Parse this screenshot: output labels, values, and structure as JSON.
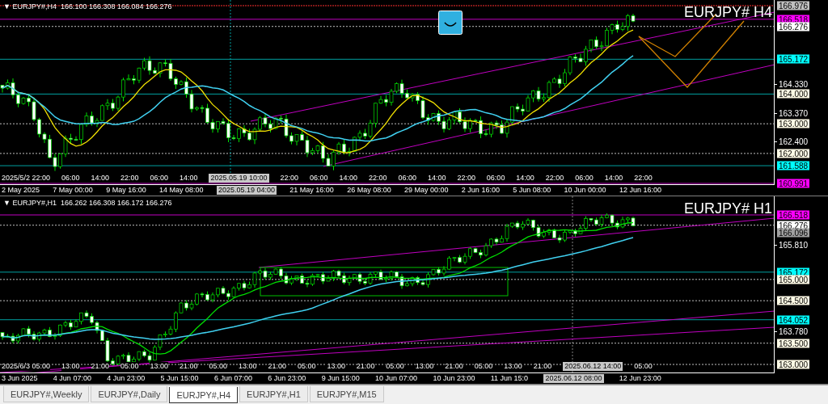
{
  "panes": [
    {
      "header": "▼ EURJPY#,H4  166.100 166.308 166.084 166.276",
      "symbol_label": "EURJPY# H4",
      "price_labels": [
        {
          "text": "166.976",
          "kind": "tag",
          "color": "#c0c0c0"
        },
        {
          "text": "166.518",
          "kind": "tag",
          "color": "#ff00ff"
        },
        {
          "text": "166.276",
          "kind": "tag",
          "color": "#ffffff"
        },
        {
          "text": "165.172",
          "kind": "tag",
          "color": "#00ffff"
        },
        {
          "text": "164.330",
          "kind": "tick"
        },
        {
          "text": "164.000",
          "kind": "tag",
          "color": "#fffbe6"
        },
        {
          "text": "163.370",
          "kind": "tick"
        },
        {
          "text": "163.000",
          "kind": "tag",
          "color": "#fffbe6"
        },
        {
          "text": "162.400",
          "kind": "tick"
        },
        {
          "text": "162.000",
          "kind": "tag",
          "color": "#fffbe6"
        },
        {
          "text": "161.588",
          "kind": "tag",
          "color": "#00ffff"
        },
        {
          "text": "160.991",
          "kind": "tag",
          "color": "#ff00ff"
        }
      ],
      "upper_time_labels": [
        {
          "text": "2025/5/2 22:00",
          "kind": "tick"
        },
        {
          "text": "06:00",
          "kind": "tick"
        },
        {
          "text": "14:00",
          "kind": "tick"
        },
        {
          "text": "22:00",
          "kind": "tick"
        },
        {
          "text": "06:00",
          "kind": "tick"
        },
        {
          "text": "14:00",
          "kind": "tick"
        },
        {
          "text": "2025.05.19 10:00",
          "kind": "crosshair"
        },
        {
          "text": "22:00",
          "kind": "tick"
        },
        {
          "text": "06:00",
          "kind": "tick"
        },
        {
          "text": "14:00",
          "kind": "tick"
        },
        {
          "text": "22:00",
          "kind": "tick"
        },
        {
          "text": "06:00",
          "kind": "tick"
        },
        {
          "text": "14:00",
          "kind": "tick"
        },
        {
          "text": "22:00",
          "kind": "tick"
        },
        {
          "text": "06:00",
          "kind": "tick"
        },
        {
          "text": "14:00",
          "kind": "tick"
        },
        {
          "text": "22:00",
          "kind": "tick"
        },
        {
          "text": "06:00",
          "kind": "tick"
        },
        {
          "text": "14:00",
          "kind": "tick"
        },
        {
          "text": "22:00",
          "kind": "tick"
        }
      ],
      "time_labels": [
        {
          "text": "2 May 2025",
          "kind": "tick"
        },
        {
          "text": "7 May 00:00",
          "kind": "tick"
        },
        {
          "text": "9 May 16:00",
          "kind": "tick"
        },
        {
          "text": "14 May 08:00",
          "kind": "tick"
        },
        {
          "text": "2025.05.19 04:00",
          "kind": "crosshair"
        },
        {
          "text": "21 May 16:00",
          "kind": "tick"
        },
        {
          "text": "26 May 08:00",
          "kind": "tick"
        },
        {
          "text": "29 May 00:00",
          "kind": "tick"
        },
        {
          "text": "2 Jun 16:00",
          "kind": "tick"
        },
        {
          "text": "5 Jun 08:00",
          "kind": "tick"
        },
        {
          "text": "10 Jun 00:00",
          "kind": "tick"
        },
        {
          "text": "12 Jun 16:00",
          "kind": "tick"
        }
      ]
    },
    {
      "header": "▼ EURJPY#,H1  166.262 166.308 166.172 166.276",
      "symbol_label": "EURJPY# H1",
      "price_labels": [
        {
          "text": "166.518",
          "kind": "tag",
          "color": "#ff00ff"
        },
        {
          "text": "166.276",
          "kind": "tag",
          "color": "#ffffff"
        },
        {
          "text": "166.096",
          "kind": "tag",
          "color": "#a0a0a0"
        },
        {
          "text": "165.810",
          "kind": "tick"
        },
        {
          "text": "165.172",
          "kind": "tag",
          "color": "#00ffff"
        },
        {
          "text": "165.000",
          "kind": "tag",
          "color": "#fffbe6"
        },
        {
          "text": "164.500",
          "kind": "tag",
          "color": "#fffbe6"
        },
        {
          "text": "164.052",
          "kind": "tag",
          "color": "#00ffff"
        },
        {
          "text": "163.780",
          "kind": "tick"
        },
        {
          "text": "163.500",
          "kind": "tag",
          "color": "#fffbe6"
        },
        {
          "text": "163.000",
          "kind": "tag",
          "color": "#fffbe6"
        }
      ],
      "upper_time_labels": [
        {
          "text": "2025/6/3 05:00",
          "kind": "tick"
        },
        {
          "text": "13:00",
          "kind": "tick"
        },
        {
          "text": "21:00",
          "kind": "tick"
        },
        {
          "text": "05:00",
          "kind": "tick"
        },
        {
          "text": "13:00",
          "kind": "tick"
        },
        {
          "text": "21:00",
          "kind": "tick"
        },
        {
          "text": "05:00",
          "kind": "tick"
        },
        {
          "text": "13:00",
          "kind": "tick"
        },
        {
          "text": "21:00",
          "kind": "tick"
        },
        {
          "text": "05:00",
          "kind": "tick"
        },
        {
          "text": "13:00",
          "kind": "tick"
        },
        {
          "text": "21:00",
          "kind": "tick"
        },
        {
          "text": "05:00",
          "kind": "tick"
        },
        {
          "text": "13:00",
          "kind": "tick"
        },
        {
          "text": "21:00",
          "kind": "tick"
        },
        {
          "text": "05:00",
          "kind": "tick"
        },
        {
          "text": "13:00",
          "kind": "tick"
        },
        {
          "text": "21:00",
          "kind": "tick"
        },
        {
          "text": "2025.06.12 14:00",
          "kind": "crosshair"
        },
        {
          "text": "05:00",
          "kind": "tick"
        }
      ],
      "time_labels": [
        {
          "text": "3 Jun 2025",
          "kind": "tick"
        },
        {
          "text": "4 Jun 07:00",
          "kind": "tick"
        },
        {
          "text": "4 Jun 23:00",
          "kind": "tick"
        },
        {
          "text": "5 Jun 15:00",
          "kind": "tick"
        },
        {
          "text": "6 Jun 07:00",
          "kind": "tick"
        },
        {
          "text": "6 Jun 23:00",
          "kind": "tick"
        },
        {
          "text": "9 Jun 15:00",
          "kind": "tick"
        },
        {
          "text": "10 Jun 07:00",
          "kind": "tick"
        },
        {
          "text": "10 Jun 23:00",
          "kind": "tick"
        },
        {
          "text": "11 Jun 15:0",
          "kind": "tick"
        },
        {
          "text": "2025.06.12 08:00",
          "kind": "crosshair"
        },
        {
          "text": "12 Jun 23:00",
          "kind": "tick"
        }
      ]
    }
  ],
  "tabs": [
    {
      "label": "EURJPY#,Weekly",
      "selected": false
    },
    {
      "label": "EURJPY#,Daily",
      "selected": false
    },
    {
      "label": "EURJPY#,H4",
      "selected": true
    },
    {
      "label": "EURJPY#,H1",
      "selected": false
    },
    {
      "label": "EURJPY#,M15",
      "selected": false
    }
  ]
}
